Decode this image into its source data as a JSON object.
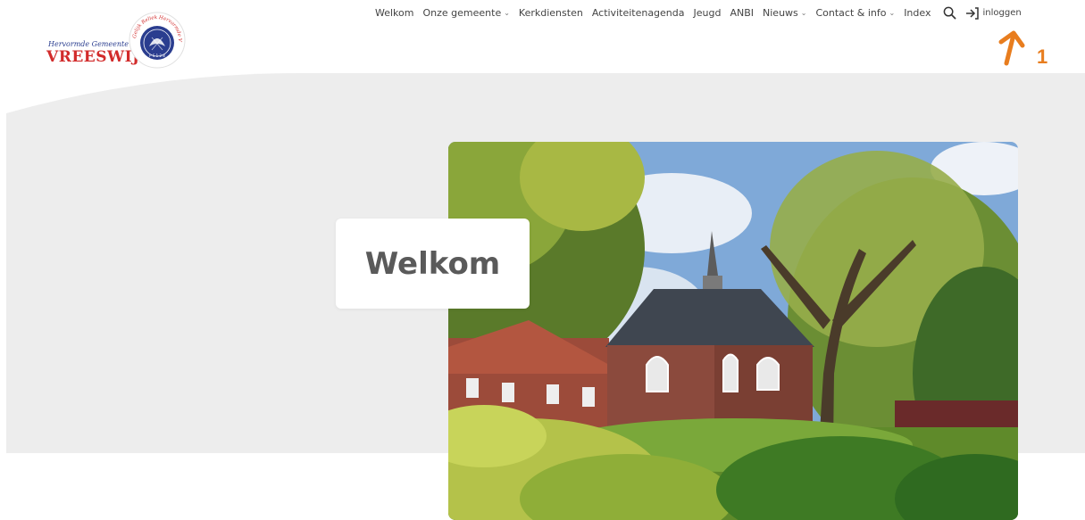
{
  "logo": {
    "line1": "Hervormde Gemeente",
    "line2": "VREESWIJK",
    "seal_text": "Gelijk Reliek Hervormde Vreeswijk",
    "colors": {
      "red": "#d22b2b",
      "blue": "#2a3d8f"
    }
  },
  "nav": {
    "items": [
      {
        "label": "Welkom",
        "dropdown": false
      },
      {
        "label": "Onze gemeente",
        "dropdown": true
      },
      {
        "label": "Kerkdiensten",
        "dropdown": false
      },
      {
        "label": "Activiteitenagenda",
        "dropdown": false
      },
      {
        "label": "Jeugd",
        "dropdown": false
      },
      {
        "label": "ANBI",
        "dropdown": false
      },
      {
        "label": "Nieuws",
        "dropdown": true
      },
      {
        "label": "Contact & info",
        "dropdown": true
      },
      {
        "label": "Index",
        "dropdown": false
      }
    ],
    "search_icon": "search-icon",
    "login_icon": "login-arrow-icon",
    "login_label": "inloggen"
  },
  "annotation": {
    "number": "1",
    "color": "#e87d1e"
  },
  "hero": {
    "title": "Welkom",
    "band_color": "#ededed",
    "photo_subject": "church-photo"
  }
}
